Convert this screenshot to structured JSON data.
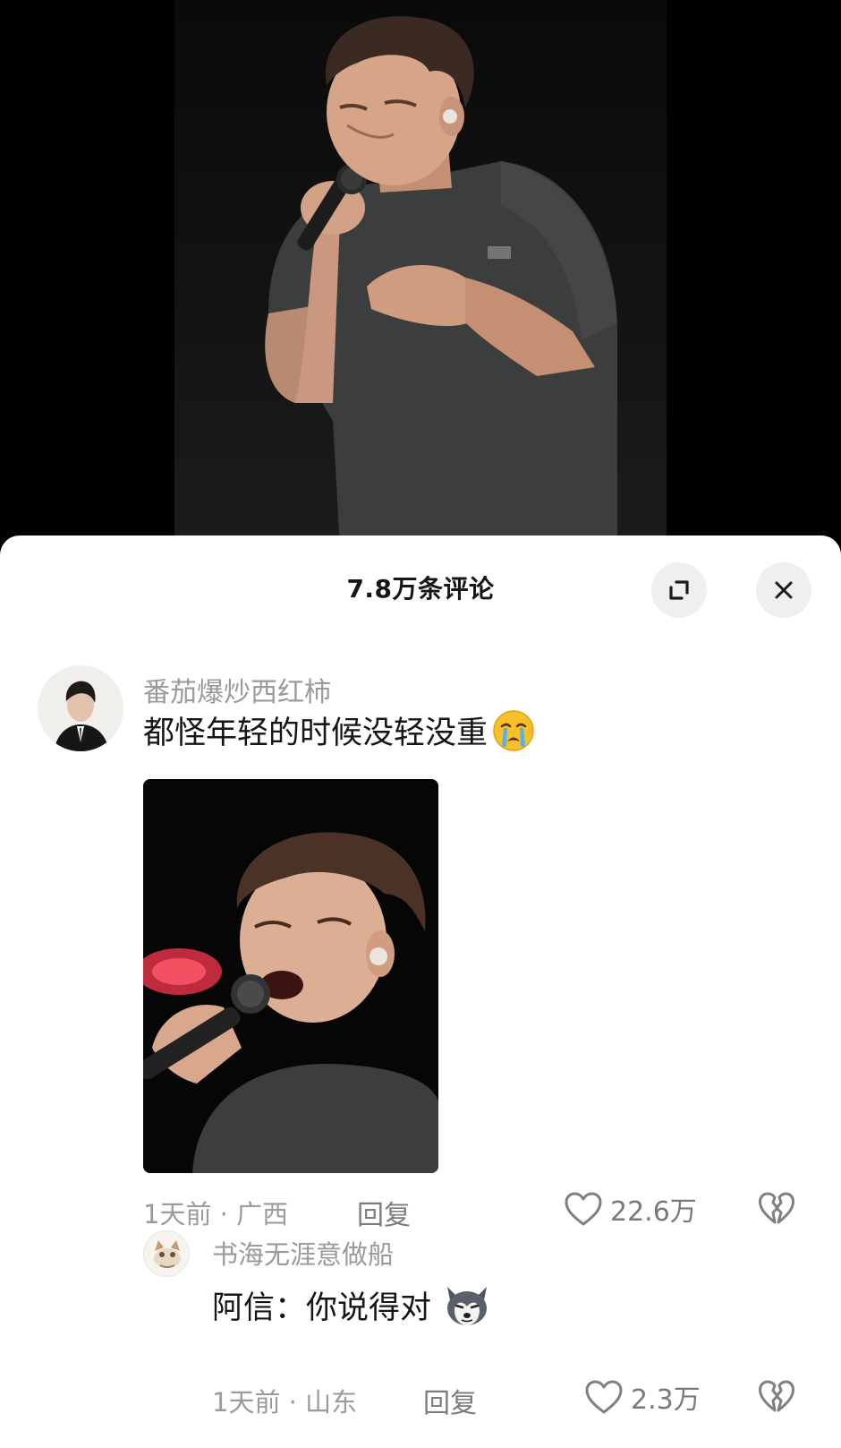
{
  "header": {
    "title": "7.8万条评论"
  },
  "comments": [
    {
      "username": "番茄爆炒西红柿",
      "text": "都怪年轻的时候没轻没重",
      "emoji": "loudly-crying-face",
      "meta": "1天前 · 广西",
      "reply_label": "回复",
      "likes": "22.6万"
    },
    {
      "username": "书海无涯意做船",
      "text": "阿信：你说得对",
      "emoji": "husky-dog-face",
      "meta": "1天前 · 山东",
      "reply_label": "回复",
      "likes": "2.3万"
    }
  ],
  "icons": {
    "expand": "expand-icon",
    "close": "close-icon",
    "like": "heart-outline-icon",
    "dislike": "broken-heart-icon"
  },
  "colors": {
    "sheet_background": "#ffffff",
    "primary_text": "#161616",
    "secondary_text": "#9a9a9a",
    "button_background": "#efeff1"
  }
}
